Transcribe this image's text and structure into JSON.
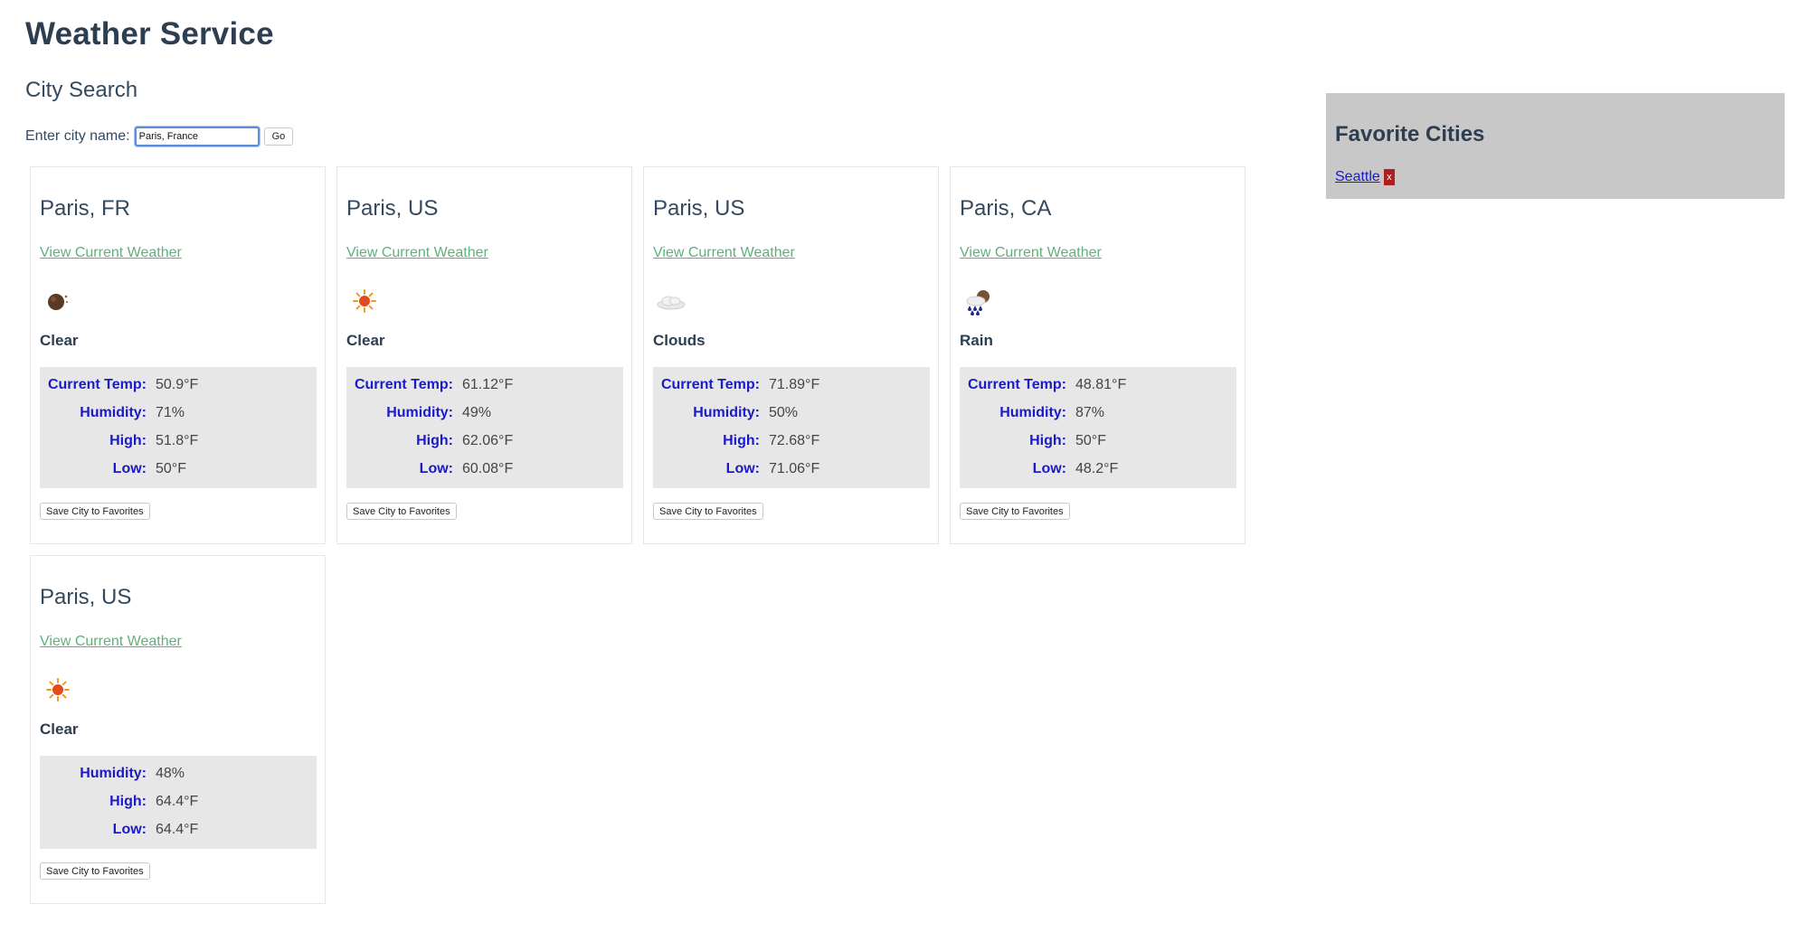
{
  "app": {
    "title": "Weather Service"
  },
  "search": {
    "section_title": "City Search",
    "label": "Enter city name:",
    "value": "Paris, France",
    "go_label": "Go"
  },
  "results": [
    {
      "city": "Paris, FR",
      "link": "View Current Weather",
      "icon": "moon-icon",
      "condition": "Clear",
      "stats": [
        {
          "label": "Current Temp:",
          "value": "50.9°F"
        },
        {
          "label": "Humidity:",
          "value": "71%"
        },
        {
          "label": "High:",
          "value": "51.8°F"
        },
        {
          "label": "Low:",
          "value": "50°F"
        }
      ],
      "save_label": "Save City to Favorites"
    },
    {
      "city": "Paris, US",
      "link": "View Current Weather",
      "icon": "sun-icon",
      "condition": "Clear",
      "stats": [
        {
          "label": "Current Temp:",
          "value": "61.12°F"
        },
        {
          "label": "Humidity:",
          "value": "49%"
        },
        {
          "label": "High:",
          "value": "62.06°F"
        },
        {
          "label": "Low:",
          "value": "60.08°F"
        }
      ],
      "save_label": "Save City to Favorites"
    },
    {
      "city": "Paris, US",
      "link": "View Current Weather",
      "icon": "cloud-icon",
      "condition": "Clouds",
      "stats": [
        {
          "label": "Current Temp:",
          "value": "71.89°F"
        },
        {
          "label": "Humidity:",
          "value": "50%"
        },
        {
          "label": "High:",
          "value": "72.68°F"
        },
        {
          "label": "Low:",
          "value": "71.06°F"
        }
      ],
      "save_label": "Save City to Favorites"
    },
    {
      "city": "Paris, CA",
      "link": "View Current Weather",
      "icon": "rain-cloud-icon",
      "condition": "Rain",
      "stats": [
        {
          "label": "Current Temp:",
          "value": "48.81°F"
        },
        {
          "label": "Humidity:",
          "value": "87%"
        },
        {
          "label": "High:",
          "value": "50°F"
        },
        {
          "label": "Low:",
          "value": "48.2°F"
        }
      ],
      "save_label": "Save City to Favorites"
    },
    {
      "city": "Paris, US",
      "link": "View Current Weather",
      "icon": "sun-icon",
      "condition": "Clear",
      "stats": [
        {
          "label": "Humidity:",
          "value": "48%"
        },
        {
          "label": "High:",
          "value": "64.4°F"
        },
        {
          "label": "Low:",
          "value": "64.4°F"
        }
      ],
      "save_label": "Save City to Favorites"
    }
  ],
  "favorites": {
    "title": "Favorite Cities",
    "items": [
      {
        "name": "Seattle",
        "remove_label": "x"
      }
    ]
  }
}
